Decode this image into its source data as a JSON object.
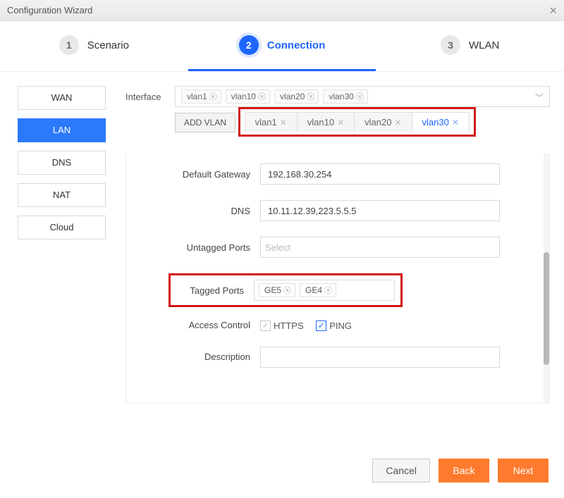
{
  "title": "Configuration Wizard",
  "steps": [
    {
      "num": "1",
      "label": "Scenario",
      "active": false
    },
    {
      "num": "2",
      "label": "Connection",
      "active": true
    },
    {
      "num": "3",
      "label": "WLAN",
      "active": false
    }
  ],
  "sidebar": {
    "items": [
      {
        "label": "WAN",
        "active": false
      },
      {
        "label": "LAN",
        "active": true
      },
      {
        "label": "DNS",
        "active": false
      },
      {
        "label": "NAT",
        "active": false
      },
      {
        "label": "Cloud",
        "active": false
      }
    ]
  },
  "interface": {
    "label": "Interface",
    "tags": [
      "vlan1",
      "vlan10",
      "vlan20",
      "vlan30"
    ],
    "add_vlan_label": "ADD VLAN"
  },
  "vlan_tabs": [
    {
      "label": "vlan1",
      "active": false
    },
    {
      "label": "vlan10",
      "active": false
    },
    {
      "label": "vlan20",
      "active": false
    },
    {
      "label": "vlan30",
      "active": true
    }
  ],
  "form": {
    "gateway": {
      "label": "Default Gateway",
      "value": "192.168.30.254"
    },
    "dns": {
      "label": "DNS",
      "value": "10.11.12.39,223.5.5.5"
    },
    "untagged": {
      "label": "Untagged Ports",
      "placeholder": "Select",
      "ports": []
    },
    "tagged": {
      "label": "Tagged Ports",
      "ports": [
        "GE5",
        "GE4"
      ]
    },
    "access": {
      "label": "Access Control",
      "opts": [
        {
          "label": "HTTPS",
          "checked": false,
          "style": "grey"
        },
        {
          "label": "PING",
          "checked": true,
          "style": "blue"
        }
      ]
    },
    "desc": {
      "label": "Description",
      "value": ""
    }
  },
  "footer": {
    "cancel": "Cancel",
    "back": "Back",
    "next": "Next"
  }
}
